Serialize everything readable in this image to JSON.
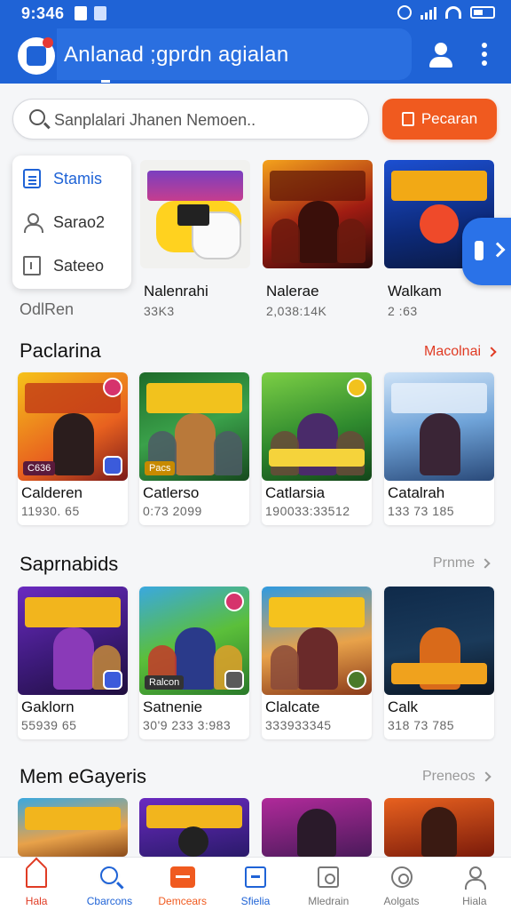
{
  "status_bar": {
    "time": "9:346"
  },
  "app_bar": {
    "title": "Anlanad ;gprdn agialan"
  },
  "search": {
    "placeholder": "Sanplalari Jhanen Nemoen..",
    "promo_button": "Pecaran"
  },
  "menu": {
    "items": [
      {
        "label": "Stamis",
        "icon": "list-icon",
        "active": true
      },
      {
        "label": "Sarao2",
        "icon": "person-icon",
        "active": false
      },
      {
        "label": "Sateeo",
        "icon": "box-icon",
        "active": false
      }
    ]
  },
  "featured": {
    "caption": "OdlRen",
    "cards": [
      {
        "name": "Nalenrahi",
        "meta": "33K3"
      },
      {
        "name": "Nalerae",
        "meta": "2,038:14K"
      },
      {
        "name": "Walkam",
        "meta": "2 :63"
      }
    ]
  },
  "sections": [
    {
      "title": "Paclarina",
      "link": "Macolnai",
      "cards": [
        {
          "name": "Calderen",
          "meta": "11930. 65",
          "tag": "C636"
        },
        {
          "name": "Catlerso",
          "meta": "0:73 2099",
          "tag": "Pacs"
        },
        {
          "name": "Catlarsia",
          "meta": "190033:33512",
          "tag": ""
        },
        {
          "name": "Catalrah",
          "meta": "133 73 185",
          "tag": ""
        }
      ]
    },
    {
      "title": "Saprnabids",
      "link": "Prnme",
      "cards": [
        {
          "name": "Gaklorn",
          "meta": "55939 65",
          "tag": ""
        },
        {
          "name": "Satnenie",
          "meta": "30'9 233 3:983",
          "tag": "Ralcon"
        },
        {
          "name": "Clalcate",
          "meta": "333933345",
          "tag": ""
        },
        {
          "name": "Calk",
          "meta": "318 73 785",
          "tag": ""
        }
      ]
    },
    {
      "title": "Mem eGayeris",
      "link": "Preneos",
      "cards": []
    }
  ],
  "bottom_nav": [
    {
      "label": "Hala",
      "icon": "home-icon"
    },
    {
      "label": "Cbarcons",
      "icon": "search-icon"
    },
    {
      "label": "Demcears",
      "icon": "games-icon"
    },
    {
      "label": "Sfielia",
      "icon": "store-icon"
    },
    {
      "label": "Mledrain",
      "icon": "media-icon"
    },
    {
      "label": "Aolgats",
      "icon": "activity-icon"
    },
    {
      "label": "Hiala",
      "icon": "profile-icon"
    }
  ],
  "colors": {
    "primary": "#1f63d6",
    "accent": "#f05a1f",
    "link_red": "#e03b24"
  }
}
